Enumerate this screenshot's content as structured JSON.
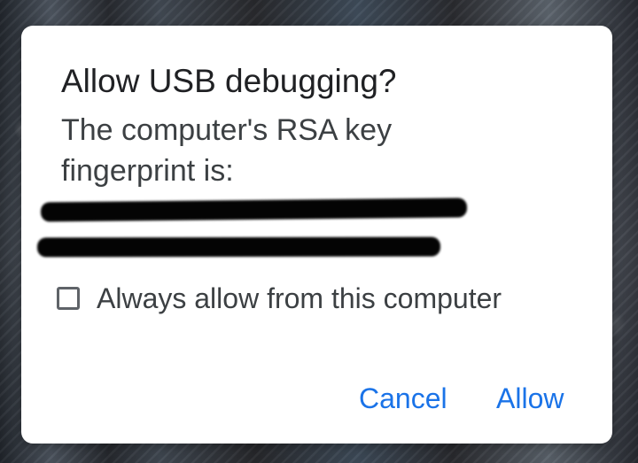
{
  "dialog": {
    "title": "Allow USB debugging?",
    "message_line_1": "The computer's RSA key",
    "message_line_2": "fingerprint is:",
    "fingerprint_redacted": true,
    "checkbox": {
      "label": "Always allow from this computer",
      "checked": false
    },
    "buttons": {
      "cancel": "Cancel",
      "allow": "Allow"
    },
    "colors": {
      "title": "#202124",
      "body": "#3c4043",
      "accent": "#1a73e8",
      "checkbox_outline": "#5f6368",
      "dialog_background": "#ffffff"
    }
  }
}
